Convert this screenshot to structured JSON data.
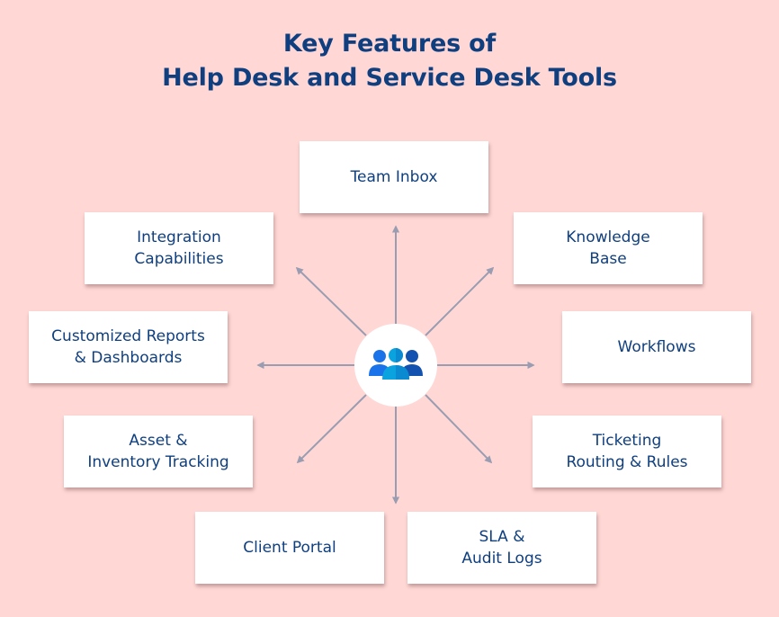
{
  "title": {
    "line1": "Key Features of",
    "line2": "Help Desk and Service Desk Tools"
  },
  "hub": {
    "icon": "team-users-icon"
  },
  "colors": {
    "background": "#FFD8D6",
    "text": "#0F3F7F",
    "arrow": "#9A9DB1",
    "icon_left": "#1A73E8",
    "icon_center": "#0AA3E0",
    "icon_right": "#1452B0"
  },
  "features": [
    {
      "id": "team-inbox",
      "lines": [
        "Team Inbox"
      ]
    },
    {
      "id": "knowledge-base",
      "lines": [
        "Knowledge",
        "Base"
      ]
    },
    {
      "id": "workflows",
      "lines": [
        "Workflows"
      ]
    },
    {
      "id": "ticketing-routing-rules",
      "lines": [
        "Ticketing",
        "Routing & Rules"
      ]
    },
    {
      "id": "sla-audit-logs",
      "lines": [
        "SLA &",
        "Audit Logs"
      ]
    },
    {
      "id": "client-portal",
      "lines": [
        "Client Portal"
      ]
    },
    {
      "id": "asset-inventory-tracking",
      "lines": [
        "Asset &",
        "Inventory Tracking"
      ]
    },
    {
      "id": "customized-reports-dashboards",
      "lines": [
        "Customized Reports",
        "& Dashboards"
      ]
    },
    {
      "id": "integration-capabilities",
      "lines": [
        "Integration",
        "Capabilities"
      ]
    }
  ]
}
